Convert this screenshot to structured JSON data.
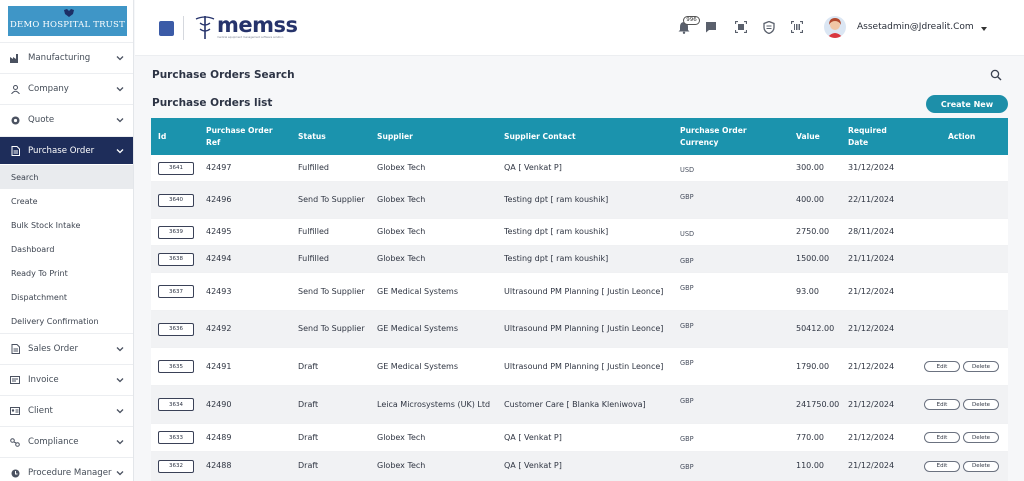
{
  "sidebar": {
    "logo_text": "DEMO HOSPITAL TRUST",
    "items": [
      {
        "label": "Manufacturing",
        "icon": "factory-icon"
      },
      {
        "label": "Company",
        "icon": "company-icon"
      },
      {
        "label": "Quote",
        "icon": "quote-icon"
      },
      {
        "label": "Purchase Order",
        "icon": "document-icon"
      },
      {
        "label": "Sales Order",
        "icon": "document-icon"
      },
      {
        "label": "Invoice",
        "icon": "invoice-icon"
      },
      {
        "label": "Client",
        "icon": "client-icon"
      },
      {
        "label": "Compliance",
        "icon": "compliance-icon"
      },
      {
        "label": "Procedure Manager",
        "icon": "procedure-icon"
      }
    ],
    "sub_items": [
      "Search",
      "Create",
      "Bulk Stock Intake",
      "Dashboard",
      "Ready To Print",
      "Dispatchment",
      "Delivery Confirmation"
    ]
  },
  "topbar": {
    "app_name": "memss",
    "app_tagline": "medical equipment management software solution",
    "notification_count": "996",
    "user_name": "Assetadmin@Jdrealit.Com"
  },
  "main": {
    "page_title": "Purchase Orders Search",
    "list_title": "Purchase Orders list",
    "create_label": "Create New"
  },
  "table": {
    "headers": {
      "id": "Id",
      "ref": "Purchase Order Ref",
      "status": "Status",
      "supplier": "Supplier",
      "contact": "Supplier Contact",
      "currency": "Purchase Order Currency",
      "value": "Value",
      "required": "Required Date",
      "action": "Action"
    },
    "edit_label": "Edit",
    "delete_label": "Delete",
    "rows": [
      {
        "id": "3641",
        "ref": "42497",
        "status": "Fulfilled",
        "supplier": "Globex Tech",
        "contact": "QA [ Venkat P]",
        "currency": "USD",
        "value": "300.00",
        "date": "31/12/2024",
        "actions": false
      },
      {
        "id": "3640",
        "ref": "42496",
        "status": "Send To Supplier",
        "supplier": "Globex Tech",
        "contact": "Testing dpt [ ram koushik]",
        "currency": "GBP",
        "value": "400.00",
        "date": "22/11/2024",
        "actions": false
      },
      {
        "id": "3639",
        "ref": "42495",
        "status": "Fulfilled",
        "supplier": "Globex Tech",
        "contact": "Testing dpt [ ram koushik]",
        "currency": "USD",
        "value": "2750.00",
        "date": "28/11/2024",
        "actions": false
      },
      {
        "id": "3638",
        "ref": "42494",
        "status": "Fulfilled",
        "supplier": "Globex Tech",
        "contact": "Testing dpt [ ram koushik]",
        "currency": "GBP",
        "value": "1500.00",
        "date": "21/11/2024",
        "actions": false
      },
      {
        "id": "3637",
        "ref": "42493",
        "status": "Send To Supplier",
        "supplier": "GE Medical Systems",
        "contact": "Ultrasound PM Planning [ Justin Leonce]",
        "currency": "GBP",
        "value": "93.00",
        "date": "21/12/2024",
        "actions": false
      },
      {
        "id": "3636",
        "ref": "42492",
        "status": "Send To Supplier",
        "supplier": "GE Medical Systems",
        "contact": "Ultrasound PM Planning [ Justin Leonce]",
        "currency": "GBP",
        "value": "50412.00",
        "date": "21/12/2024",
        "actions": false
      },
      {
        "id": "3635",
        "ref": "42491",
        "status": "Draft",
        "supplier": "GE Medical Systems",
        "contact": "Ultrasound PM Planning [ Justin Leonce]",
        "currency": "GBP",
        "value": "1790.00",
        "date": "21/12/2024",
        "actions": true
      },
      {
        "id": "3634",
        "ref": "42490",
        "status": "Draft",
        "supplier": "Leica Microsystems (UK) Ltd",
        "contact": "Customer Care [ Blanka Kleniwova]",
        "currency": "GBP",
        "value": "241750.00",
        "date": "21/12/2024",
        "actions": true
      },
      {
        "id": "3633",
        "ref": "42489",
        "status": "Draft",
        "supplier": "Globex Tech",
        "contact": "QA [ Venkat P]",
        "currency": "GBP",
        "value": "770.00",
        "date": "21/12/2024",
        "actions": true
      },
      {
        "id": "3632",
        "ref": "42488",
        "status": "Draft",
        "supplier": "Globex Tech",
        "contact": "QA [ Venkat P]",
        "currency": "GBP",
        "value": "110.00",
        "date": "21/12/2024",
        "actions": true
      }
    ]
  }
}
